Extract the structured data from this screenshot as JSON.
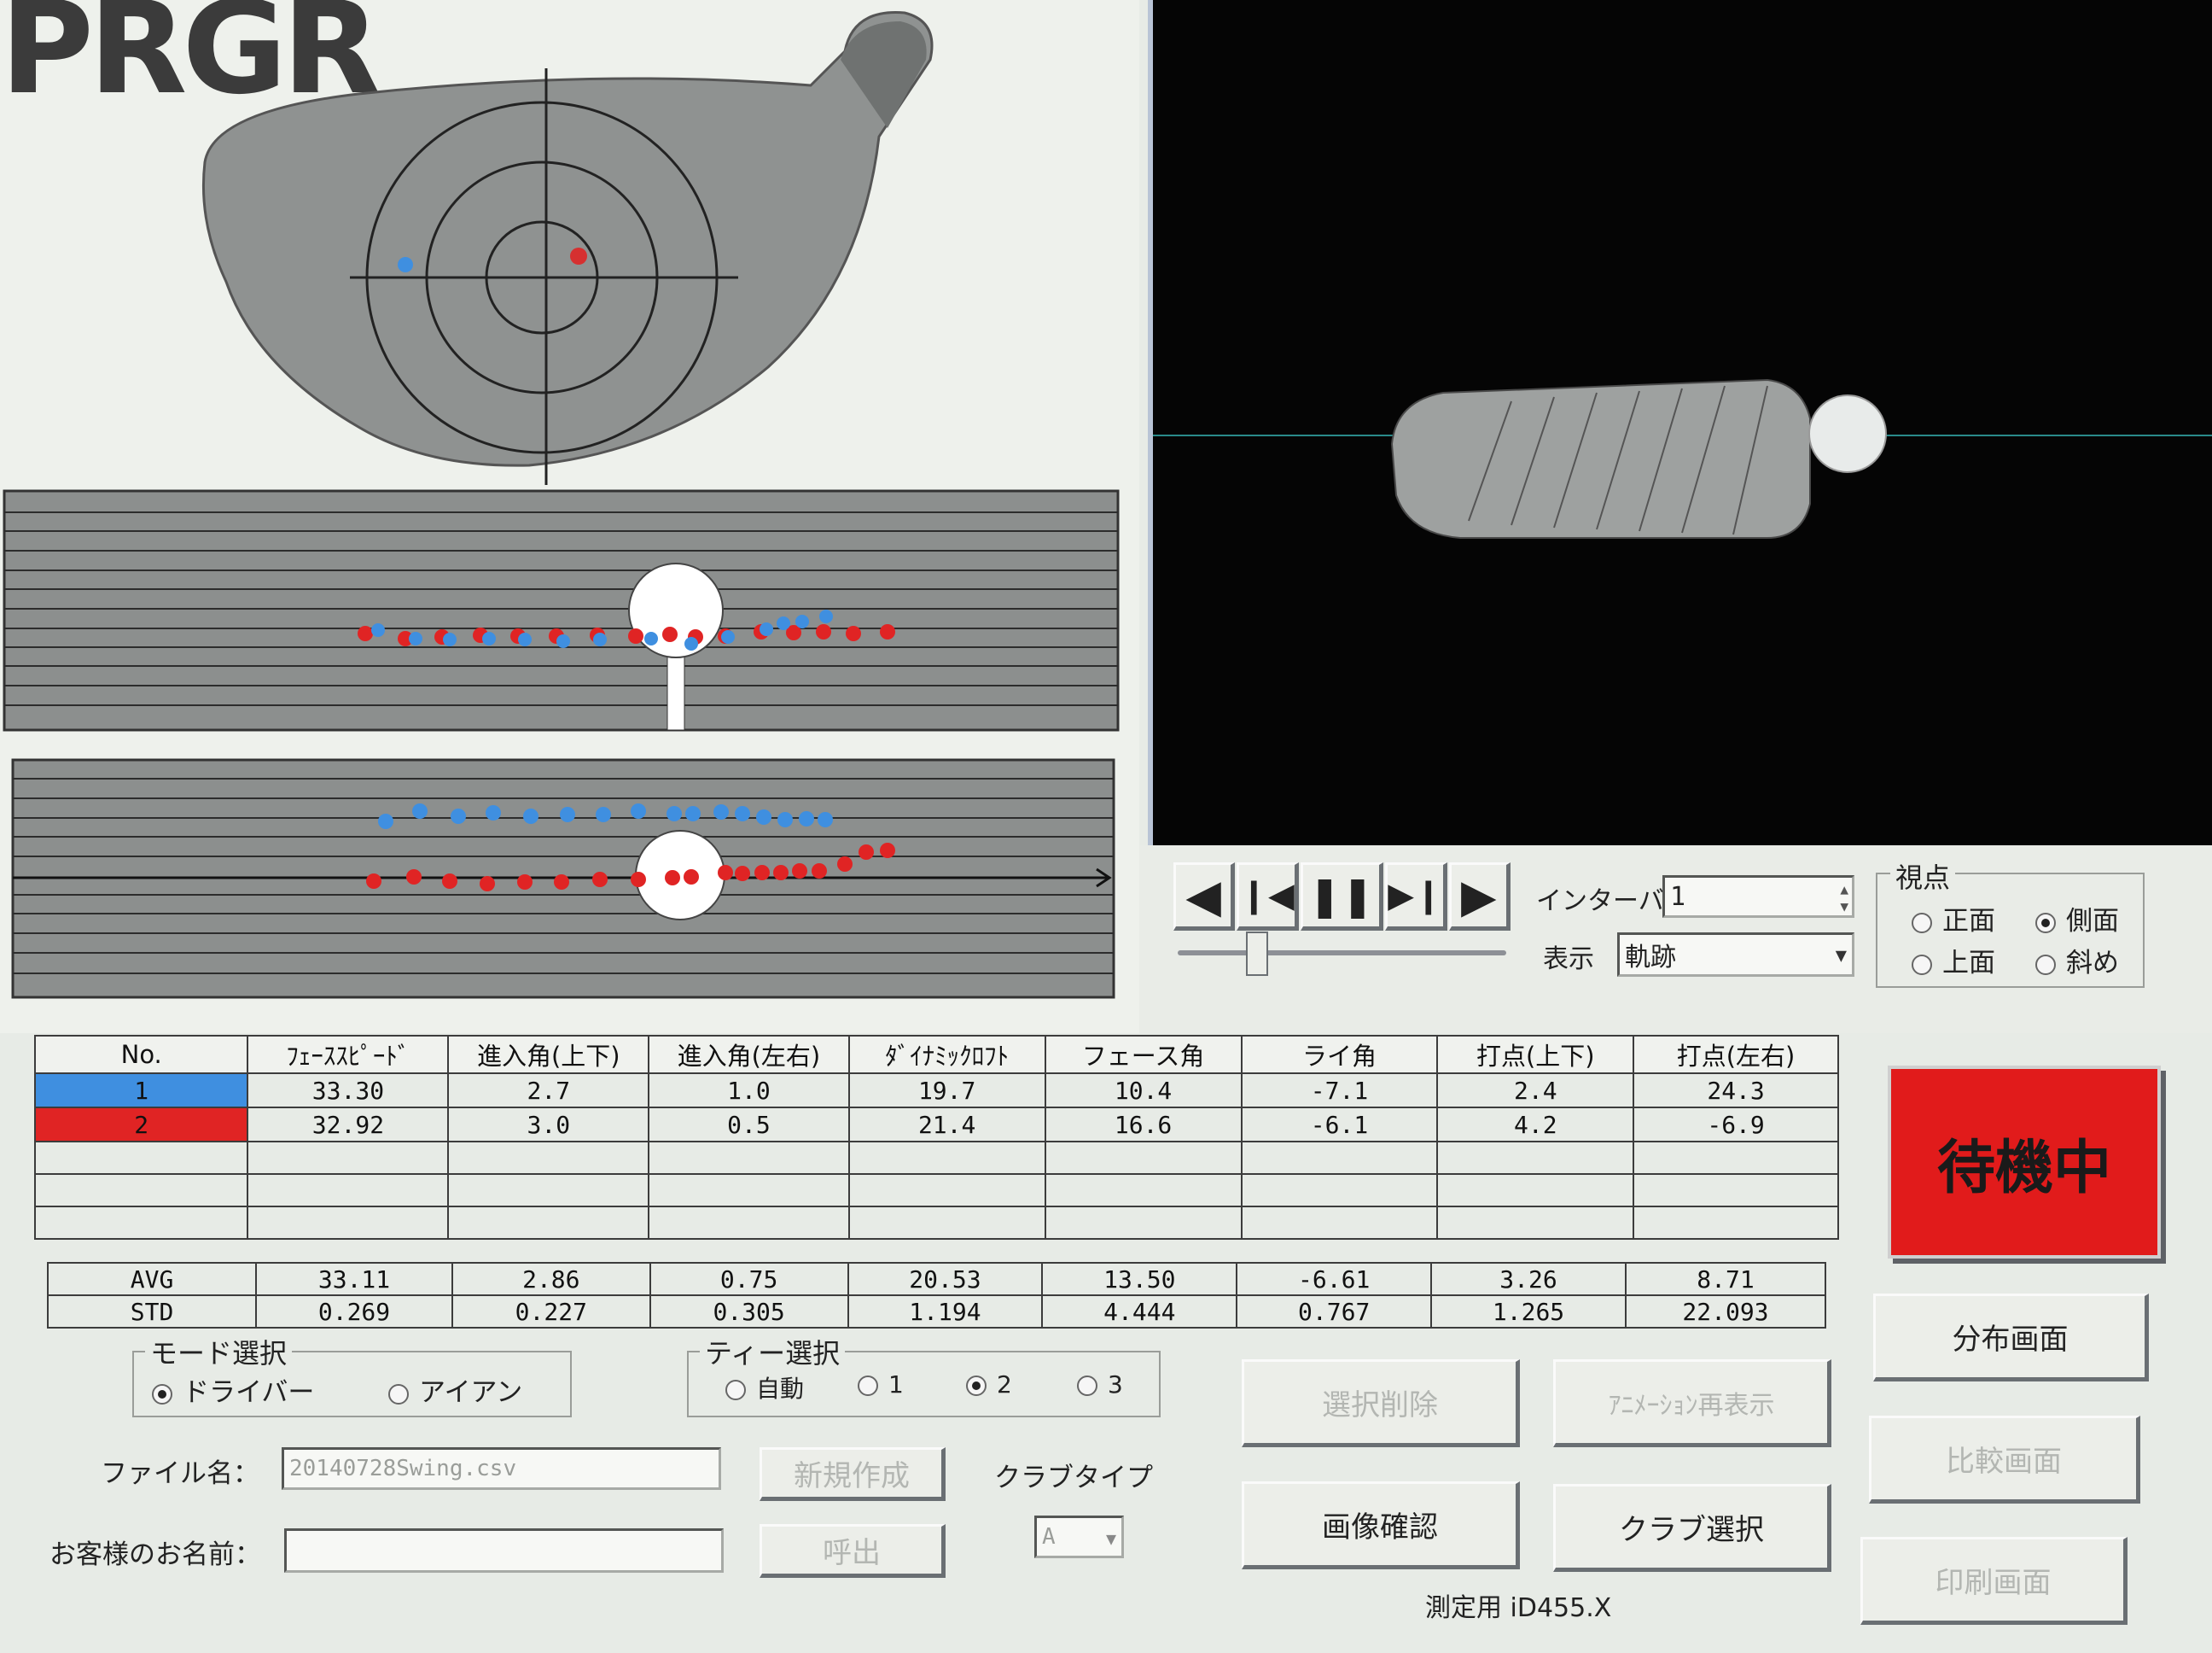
{
  "brand": "PRGR",
  "playback": {
    "interval_label": "インターバル",
    "interval_value": "1",
    "display_label": "表示",
    "display_value": "軌跡"
  },
  "viewpoint": {
    "title": "視点",
    "options": [
      {
        "label": "正面",
        "checked": false
      },
      {
        "label": "側面",
        "checked": true
      },
      {
        "label": "上面",
        "checked": false
      },
      {
        "label": "斜め",
        "checked": false
      }
    ]
  },
  "table": {
    "headers": [
      "No.",
      "ﾌｪｰｽｽﾋﾟｰﾄﾞ",
      "進入角(上下)",
      "進入角(左右)",
      "ﾀﾞｲﾅﾐｯｸﾛﾌﾄ",
      "フェース角",
      "ライ角",
      "打点(上下)",
      "打点(左右)"
    ],
    "rows": [
      {
        "no": "1",
        "color": "#3f8fe0",
        "values": [
          "33.30",
          "2.7",
          "1.0",
          "19.7",
          "10.4",
          "-7.1",
          "2.4",
          "24.3"
        ]
      },
      {
        "no": "2",
        "color": "#e02424",
        "values": [
          "32.92",
          "3.0",
          "0.5",
          "21.4",
          "16.6",
          "-6.1",
          "4.2",
          "-6.9"
        ]
      }
    ],
    "avg_label": "AVG",
    "avg": [
      "33.11",
      "2.86",
      "0.75",
      "20.53",
      "13.50",
      "-6.61",
      "3.26",
      "8.71"
    ],
    "std_label": "STD",
    "std": [
      "0.269",
      "0.227",
      "0.305",
      "1.194",
      "4.444",
      "0.767",
      "1.265",
      "22.093"
    ]
  },
  "status": "待機中",
  "mode": {
    "title": "モード選択",
    "options": [
      {
        "label": "ドライバー",
        "checked": true
      },
      {
        "label": "アイアン",
        "checked": false
      }
    ]
  },
  "tee": {
    "title": "ティー選択",
    "options": [
      {
        "label": "自動",
        "checked": false
      },
      {
        "label": "1",
        "checked": false
      },
      {
        "label": "2",
        "checked": true
      },
      {
        "label": "3",
        "checked": false
      }
    ]
  },
  "file": {
    "label": "ファイル名：",
    "value": "20140728Swing.csv"
  },
  "customer": {
    "label": "お客様のお名前：",
    "value": ""
  },
  "buttons": {
    "new": "新規作成",
    "call": "呼出",
    "club_type_label": "クラブタイプ",
    "club_type_value": "A",
    "delete": "選択削除",
    "replay": "ｱﾆﾒｰｼｮﾝ再表示",
    "image": "画像確認",
    "club_select": "クラブ選択",
    "distribution": "分布画面",
    "compare": "比較画面",
    "print": "印刷画面"
  },
  "footer": "測定用 iD455.X",
  "colors": {
    "status_red": "#e11b1b",
    "shot1": "#3f8fe0",
    "shot2": "#e02424"
  }
}
